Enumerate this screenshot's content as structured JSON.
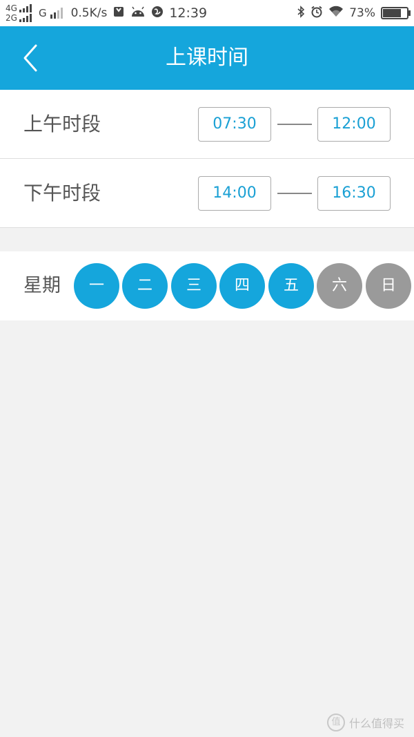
{
  "status_bar": {
    "net1": "4G",
    "net2": "2G",
    "net3": "G",
    "speed": "0.5K/s",
    "time": "12:39",
    "battery": "73%",
    "battery_level": 0.73
  },
  "header": {
    "title": "上课时间",
    "back_icon": "chevron-left-icon"
  },
  "schedule": {
    "morning": {
      "label": "上午时段",
      "start": "07:30",
      "end": "12:00"
    },
    "afternoon": {
      "label": "下午时段",
      "start": "14:00",
      "end": "16:30"
    }
  },
  "week": {
    "label": "星期",
    "days": [
      {
        "label": "一",
        "selected": true
      },
      {
        "label": "二",
        "selected": true
      },
      {
        "label": "三",
        "selected": true
      },
      {
        "label": "四",
        "selected": true
      },
      {
        "label": "五",
        "selected": true
      },
      {
        "label": "六",
        "selected": false
      },
      {
        "label": "日",
        "selected": false
      }
    ]
  },
  "watermark": {
    "logo": "值",
    "text": "什么值得买"
  },
  "colors": {
    "accent": "#15a6dc",
    "day_off": "#9a9a9a",
    "background": "#f2f2f2"
  }
}
